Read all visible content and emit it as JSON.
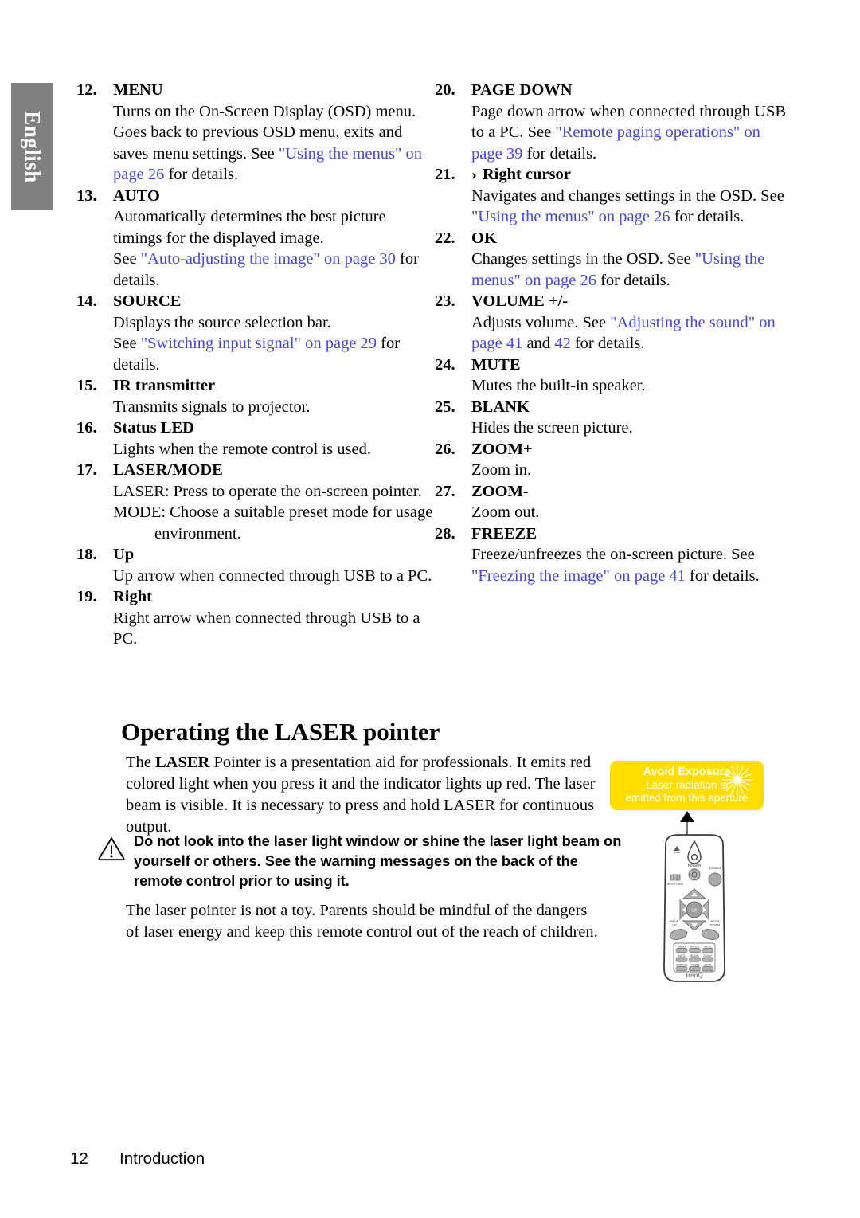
{
  "sidebar": {
    "language_tab": "English"
  },
  "columns": {
    "left": [
      {
        "num": "12.",
        "title": "MENU",
        "desc_parts": [
          {
            "text": "Turns on the On-Screen Display (OSD) menu. Goes back to previous OSD menu, exits and saves menu settings. See ",
            "link": false
          },
          {
            "text": "\"Using the menus\" on page 26",
            "link": true
          },
          {
            "text": " for details.",
            "link": false
          }
        ]
      },
      {
        "num": "13.",
        "title": "AUTO",
        "desc_parts": [
          {
            "text": "Automatically determines the best picture timings for the displayed image.",
            "link": false
          }
        ],
        "extra_parts": [
          {
            "text": "See ",
            "link": false
          },
          {
            "text": "\"Auto-adjusting the image\" on page 30",
            "link": true
          },
          {
            "text": " for details.",
            "link": false
          }
        ]
      },
      {
        "num": "14.",
        "title": "SOURCE",
        "desc_parts": [
          {
            "text": "Displays the source selection bar.",
            "link": false
          }
        ],
        "extra_parts": [
          {
            "text": "See ",
            "link": false
          },
          {
            "text": "\"Switching input signal\" on page 29",
            "link": true
          },
          {
            "text": " for details.",
            "link": false
          }
        ]
      },
      {
        "num": "15.",
        "title": "IR transmitter",
        "desc_parts": [
          {
            "text": "Transmits signals to projector.",
            "link": false
          }
        ]
      },
      {
        "num": "16.",
        "title": "Status LED",
        "desc_parts": [
          {
            "text": "Lights when the remote control is used.",
            "link": false
          }
        ]
      },
      {
        "num": "17.",
        "title": "LASER/MODE",
        "sub_lines": [
          "LASER: Press to operate the on-screen pointer.",
          "MODE: Choose a suitable preset mode for usage environment."
        ]
      },
      {
        "num": "18.",
        "title": "Up",
        "desc_parts": [
          {
            "text": "Up arrow when connected through USB to a PC.",
            "link": false
          }
        ]
      },
      {
        "num": "19.",
        "title": "Right",
        "desc_parts": [
          {
            "text": "Right arrow when connected through USB to a PC.",
            "link": false
          }
        ]
      }
    ],
    "right": [
      {
        "num": "20.",
        "title": "PAGE DOWN",
        "desc_parts": [
          {
            "text": "Page down arrow when connected through USB to a PC. See ",
            "link": false
          },
          {
            "text": "\"Remote paging operations\" on page 39",
            "link": true
          },
          {
            "text": " for details.",
            "link": false
          }
        ]
      },
      {
        "num": "21.",
        "glyph": "›",
        "title": "Right cursor",
        "desc_parts": [
          {
            "text": "Navigates and changes settings in the OSD. See ",
            "link": false
          },
          {
            "text": "\"Using the menus\" on page 26",
            "link": true
          },
          {
            "text": " for details.",
            "link": false
          }
        ]
      },
      {
        "num": "22.",
        "title": "OK",
        "desc_parts": [
          {
            "text": "Changes settings in the OSD. See ",
            "link": false
          },
          {
            "text": "\"Using the menus\" on page 26",
            "link": true
          },
          {
            "text": " for details.",
            "link": false
          }
        ]
      },
      {
        "num": "23.",
        "title": "VOLUME +/-",
        "desc_parts": [
          {
            "text": "Adjusts volume. See ",
            "link": false
          },
          {
            "text": "\"Adjusting the sound\" on page 41",
            "link": true
          },
          {
            "text": " and ",
            "link": false
          },
          {
            "text": "42",
            "link": true
          },
          {
            "text": " for details.",
            "link": false
          }
        ]
      },
      {
        "num": "24.",
        "title": "MUTE",
        "desc_parts": [
          {
            "text": "Mutes the built-in speaker.",
            "link": false
          }
        ]
      },
      {
        "num": "25.",
        "title": "BLANK",
        "desc_parts": [
          {
            "text": "Hides the screen picture.",
            "link": false
          }
        ]
      },
      {
        "num": "26.",
        "title": "ZOOM+",
        "desc_parts": [
          {
            "text": "Zoom in.",
            "link": false
          }
        ]
      },
      {
        "num": "27.",
        "title": "ZOOM-",
        "desc_parts": [
          {
            "text": "Zoom out.",
            "link": false
          }
        ]
      },
      {
        "num": "28.",
        "title": "FREEZE",
        "desc_parts": [
          {
            "text": "Freeze/unfreezes the on-screen picture. See ",
            "link": false
          },
          {
            "text": "\"Freezing the image\" on page 41",
            "link": true
          },
          {
            "text": " for details.",
            "link": false
          }
        ]
      }
    ]
  },
  "section": {
    "heading": "Operating the LASER pointer",
    "intro_pre": "The ",
    "intro_bold": "LASER",
    "intro_post": " Pointer is a presentation aid for professionals. It emits red colored light when you press it and the indicator lights up red. The laser beam is visible. It is necessary to press and hold LASER for continuous output.",
    "warning": "Do not look into the laser light window or shine the laser light beam on yourself or others. See the warning messages on the back of the remote control prior to using it.",
    "closing": "The laser pointer is not a toy. Parents should be mindful of the dangers of laser energy and keep this remote control out of the reach of children."
  },
  "laser_label": {
    "title": "Avoid Exposure",
    "line1": "Laser radiation is",
    "line2": "emitted from this aperture",
    "background_color": "#FFDD00",
    "text_color": "#FFFFFF"
  },
  "remote": {
    "power_label": "POWER",
    "laser_label": "LASER",
    "source_label": "SOURCE",
    "page_up_label": "PAGE UP",
    "page_down_label": "PAGE DOWN",
    "ok_label": "OK",
    "keystone_label": "KEYSTONE",
    "volume_label": "VOLUME",
    "brand": "BenQ",
    "keys": [
      [
        "MENU",
        "STATUS",
        "MUTE"
      ],
      [
        "AUTO",
        "BLANK",
        "ZOOM+"
      ],
      [
        "SOURCE",
        "FREEZE",
        "ZOOM-"
      ]
    ]
  },
  "footer": {
    "page_number": "12",
    "section_name": "Introduction"
  },
  "colors": {
    "link": "#4346e0",
    "tab_gray": "#808080",
    "warning_yellow": "#FFDD00"
  }
}
